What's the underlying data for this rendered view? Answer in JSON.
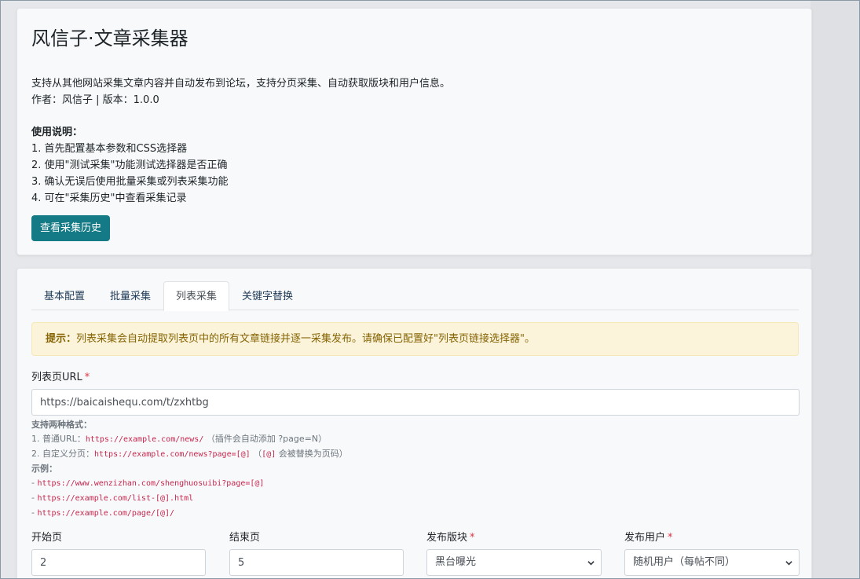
{
  "header": {
    "title": "风信子·文章采集器",
    "description": "支持从其他网站采集文章内容并自动发布到论坛，支持分页采集、自动获取版块和用户信息。",
    "meta": "作者：风信子 | 版本：1.0.0",
    "usage_title": "使用说明：",
    "usage_steps": [
      "1. 首先配置基本参数和CSS选择器",
      "2. 使用\"测试采集\"功能测试选择器是否正确",
      "3. 确认无误后使用批量采集或列表采集功能",
      "4. 可在\"采集历史\"中查看采集记录"
    ],
    "history_button": "查看采集历史"
  },
  "tabs": [
    {
      "label": "基本配置",
      "active": false
    },
    {
      "label": "批量采集",
      "active": false
    },
    {
      "label": "列表采集",
      "active": true
    },
    {
      "label": "关键字替换",
      "active": false
    }
  ],
  "alert": {
    "prefix": "提示：",
    "text": "列表采集会自动提取列表页中的所有文章链接并逐一采集发布。请确保已配置好\"列表页链接选择器\"。"
  },
  "form": {
    "list_url_label": "列表页URL",
    "required_mark": "*",
    "list_url_value": "https://baicaishequ.com/t/zxhtbg",
    "help": {
      "formats_title": "支持两种格式：",
      "format1_prefix": "1. 普通URL：",
      "format1_code": "https://example.com/news/",
      "format1_suffix": "（插件会自动添加 ?page=N）",
      "format2_prefix": "2. 自定义分页：",
      "format2_code": "https://example.com/news?page=[@]",
      "format2_mid": "（",
      "format2_code2": "[@]",
      "format2_suffix": "会被替换为页码）",
      "examples_title": "示例：",
      "examples": [
        "https://www.wenzizhan.com/shenghuosuibi?page=[@]",
        "https://example.com/list-[@].html",
        "https://example.com/page/[@]/"
      ],
      "example_dash": "- "
    },
    "start_page_label": "开始页",
    "start_page_value": "2",
    "end_page_label": "结束页",
    "end_page_value": "5",
    "forum_label": "发布版块",
    "forum_value": "黑台曝光",
    "user_label": "发布用户",
    "user_value": "随机用户（每帖不同）"
  },
  "colors": {
    "primary_button": "#147a85",
    "alert_bg": "#fcf4da",
    "alert_text": "#856404",
    "required": "#dc3545",
    "code": "#c7254e"
  },
  "icons": {
    "select_arrow": "chevron-down-icon"
  }
}
